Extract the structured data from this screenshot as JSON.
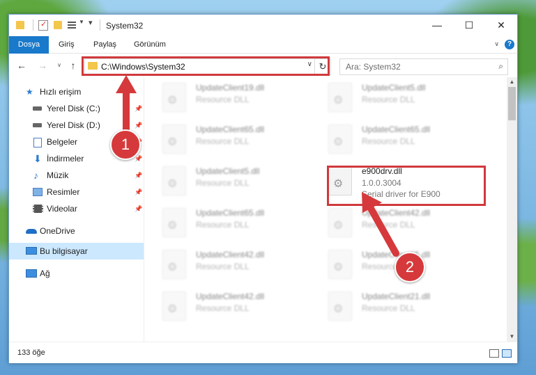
{
  "window": {
    "title": "System32",
    "controls": {
      "minimize": "—",
      "maximize": "☐",
      "close": "✕"
    }
  },
  "ribbon": {
    "tabs": [
      {
        "label": "Dosya"
      },
      {
        "label": "Giriş"
      },
      {
        "label": "Paylaş"
      },
      {
        "label": "Görünüm"
      }
    ],
    "help": "?"
  },
  "address": {
    "path": "C:\\Windows\\System32",
    "search_placeholder": "Ara: System32"
  },
  "sidebar": {
    "items": [
      {
        "label": "Hızlı erişim",
        "icon": "star-icon"
      },
      {
        "label": "Yerel Disk (C:)",
        "icon": "drive-icon"
      },
      {
        "label": "Yerel Disk (D:)",
        "icon": "drive-icon"
      },
      {
        "label": "Belgeler",
        "icon": "documents-icon"
      },
      {
        "label": "İndirmeler",
        "icon": "download-icon"
      },
      {
        "label": "Müzik",
        "icon": "music-icon"
      },
      {
        "label": "Resimler",
        "icon": "pictures-icon"
      },
      {
        "label": "Videolar",
        "icon": "video-icon"
      },
      {
        "label": "OneDrive",
        "icon": "cloud-icon"
      },
      {
        "label": "Bu bilgisayar",
        "icon": "computer-icon"
      },
      {
        "label": "Ağ",
        "icon": "network-icon"
      }
    ]
  },
  "files": {
    "left": [
      {
        "name": "UpdateClient19.dll",
        "sub": "Resource DLL"
      },
      {
        "name": "UpdateClient65.dll",
        "sub": "Resource DLL"
      },
      {
        "name": "UpdateClient5.dll",
        "sub": "Resource DLL"
      },
      {
        "name": "UpdateClient65.dll",
        "sub": "Resource DLL"
      },
      {
        "name": "UpdateClient42.dll",
        "sub": "Resource DLL"
      },
      {
        "name": "UpdateClient42.dll",
        "sub": "Resource DLL"
      }
    ],
    "right": [
      {
        "name": "UpdateClient5.dll",
        "sub": "Resource DLL"
      },
      {
        "name": "UpdateClient65.dll",
        "sub": "Resource DLL"
      },
      {
        "name": "UpdateClient42.dll",
        "sub": "Resource DLL"
      },
      {
        "name": "UpdateClient65.dll",
        "sub": "Resource DLL"
      },
      {
        "name": "UpdateClient21.dll",
        "sub": "Resource DLL"
      }
    ],
    "highlighted": {
      "name": "e900drv.dll",
      "version": "1.0.0.3004",
      "description": "Serial driver for E900"
    }
  },
  "status": {
    "count": "133 öğe"
  },
  "annotations": {
    "step1": "1",
    "step2": "2",
    "color": "#d6393b"
  }
}
